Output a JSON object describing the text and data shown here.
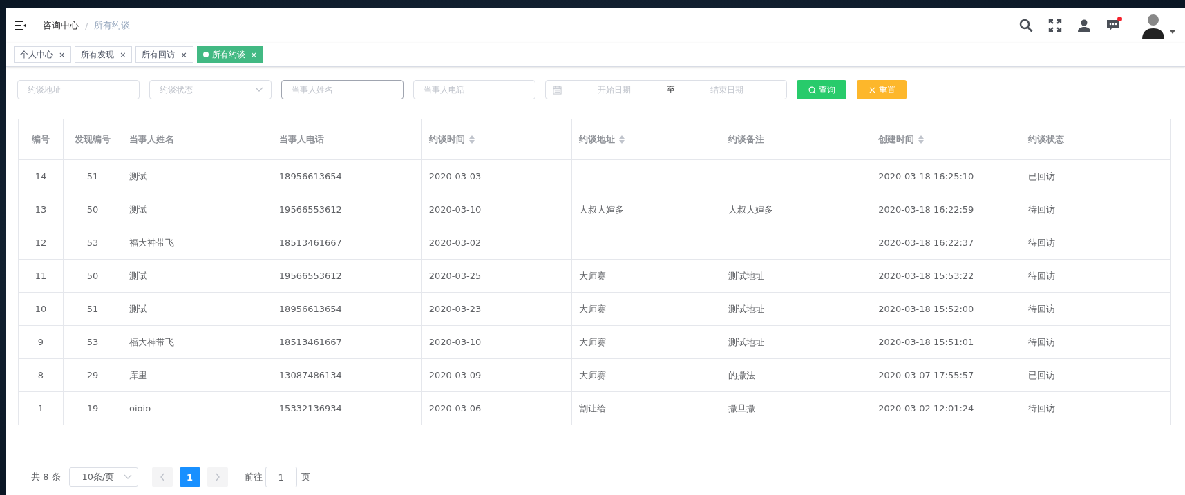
{
  "header": {
    "breadcrumb": [
      {
        "label": "咨询中心",
        "current": false
      },
      {
        "label": "所有约谈",
        "current": true
      }
    ],
    "separator": "/",
    "has_unread": true
  },
  "tabs": [
    {
      "label": "个人中心",
      "close": "×",
      "selected": false
    },
    {
      "label": "所有发现",
      "close": "×",
      "selected": false
    },
    {
      "label": "所有回访",
      "close": "×",
      "selected": false
    },
    {
      "label": "所有约谈",
      "close": "×",
      "selected": true
    }
  ],
  "filters": [
    {
      "kind": "input",
      "placeholder": "约谈地址",
      "focused": false
    },
    {
      "kind": "select",
      "placeholder": "约谈状态",
      "focused": false
    },
    {
      "kind": "input",
      "placeholder": "当事人姓名",
      "focused": true
    },
    {
      "kind": "input",
      "placeholder": "当事人电话",
      "focused": false
    }
  ],
  "date_range": {
    "start_placeholder": "开始日期",
    "separator": "至",
    "end_placeholder": "结束日期"
  },
  "buttons": [
    {
      "kind": "search",
      "label": "查询"
    },
    {
      "kind": "reset",
      "label": "重置"
    }
  ],
  "table": {
    "columns": [
      {
        "label": "编号",
        "sortable": false
      },
      {
        "label": "发现编号",
        "sortable": false
      },
      {
        "label": "当事人姓名",
        "sortable": false
      },
      {
        "label": "当事人电话",
        "sortable": false
      },
      {
        "label": "约谈时间",
        "sortable": true
      },
      {
        "label": "约谈地址",
        "sortable": true
      },
      {
        "label": "约谈备注",
        "sortable": false
      },
      {
        "label": "创建时间",
        "sortable": true
      },
      {
        "label": "约谈状态",
        "sortable": false
      }
    ],
    "rows": [
      [
        "14",
        "51",
        "测试",
        "18956613654",
        "2020-03-03",
        "",
        "",
        "2020-03-18 16:25:10",
        "已回访"
      ],
      [
        "13",
        "50",
        "测试",
        "19566553612",
        "2020-03-10",
        "大叔大婶多",
        "大叔大婶多",
        "2020-03-18 16:22:59",
        "待回访"
      ],
      [
        "12",
        "53",
        "福大神带飞",
        "18513461667",
        "2020-03-02",
        "",
        "",
        "2020-03-18 16:22:37",
        "待回访"
      ],
      [
        "11",
        "50",
        "测试",
        "19566553612",
        "2020-03-25",
        "大师赛",
        "测试地址",
        "2020-03-18 15:53:22",
        "待回访"
      ],
      [
        "10",
        "51",
        "测试",
        "18956613654",
        "2020-03-23",
        "大师赛",
        "测试地址",
        "2020-03-18 15:52:00",
        "待回访"
      ],
      [
        "9",
        "53",
        "福大神带飞",
        "18513461667",
        "2020-03-10",
        "大师赛",
        "测试地址",
        "2020-03-18 15:51:01",
        "待回访"
      ],
      [
        "8",
        "29",
        "库里",
        "13087486134",
        "2020-03-09",
        "大师赛",
        "的撒法",
        "2020-03-07 17:55:57",
        "已回访"
      ],
      [
        "1",
        "19",
        "oioio",
        "15332136934",
        "2020-03-06",
        "割让给",
        "撒旦撒",
        "2020-03-02 12:01:24",
        "待回访"
      ]
    ]
  },
  "pagination": {
    "total": "共 8 条",
    "page_size": "10条/页",
    "pages": [
      {
        "label": "1",
        "selected": true
      }
    ],
    "goto_label": "前往",
    "goto_value": "1",
    "page_unit": "页"
  }
}
